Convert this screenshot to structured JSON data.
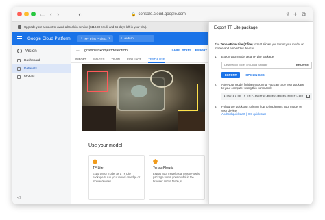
{
  "browser": {
    "url": "console.cloud.google.com"
  },
  "banner": {
    "text": "Upgrade your account to avoid a break in service ($110.99 credit and 66 days left in your trial)."
  },
  "header": {
    "title": "Google Cloud Platform",
    "project": "My First Project",
    "search_value": "automl"
  },
  "sidebar": {
    "product": "Vision",
    "items": [
      {
        "label": "Dashboard",
        "active": false
      },
      {
        "label": "Datasets",
        "active": true
      },
      {
        "label": "Models",
        "active": false
      }
    ]
  },
  "main": {
    "model_name": "graviosinkobjectdetection",
    "actions": {
      "label_stats": "LABEL STATS",
      "export": "EXPORT"
    },
    "tabs": [
      {
        "label": "IMPORT",
        "active": false
      },
      {
        "label": "IMAGES",
        "active": false
      },
      {
        "label": "TRAIN",
        "active": false
      },
      {
        "label": "EVALUATE",
        "active": false
      },
      {
        "label": "TEST & USE",
        "active": true
      }
    ],
    "use_title": "Use your model",
    "cards": [
      {
        "title": "TF Lite",
        "desc": "Export your model as a TF Lite package to run your model on edge or mobile devices."
      },
      {
        "title": "TensorFlow.js",
        "desc": "Export your model as a TensorFlow.js package to run your model in the browser and in Node.js."
      }
    ]
  },
  "panel": {
    "title": "Export TF Lite package",
    "intro_bold": "TensorFlow Lite (.tflite)",
    "intro_pre": "The ",
    "intro_post": " format allows you to run your model on mobile and embedded devices.",
    "step1": "Export your model as a TF Lite package",
    "dest_placeholder": "Destination folder on Cloud Storage",
    "browse": "BROWSE",
    "export_button": "EXPORT",
    "open_gcs": "OPEN IN GCS",
    "step2": "After your model finishes exporting, you can copy your package to your computer using this command:",
    "command": "$ gsutil cp -r gs://asterie-models/model-export/icn",
    "step3": "Follow the quickstart to learn how to implement your model on your device.",
    "quickstart_link": "Android quickstart | iOS quickstart"
  }
}
